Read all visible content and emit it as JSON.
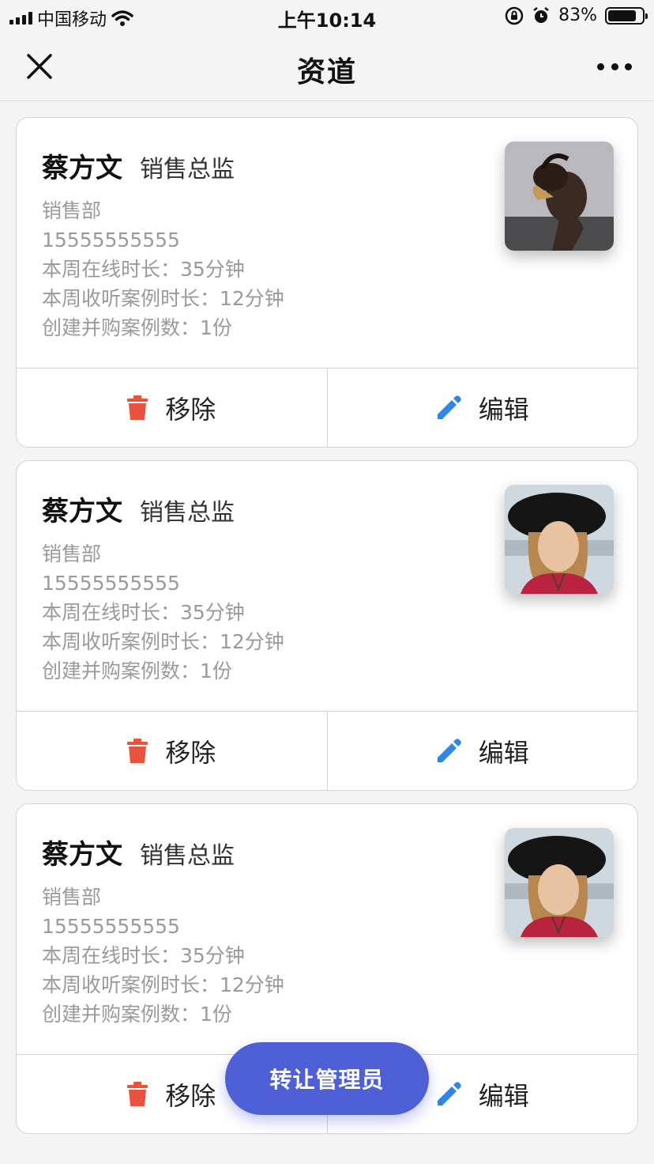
{
  "status_bar": {
    "carrier": "中国移动",
    "time": "上午10:14",
    "battery": "83%",
    "battery_level": 0.83
  },
  "nav": {
    "title": "资道"
  },
  "cards": [
    {
      "name": "蔡方文",
      "title": "销售总监",
      "department": "销售部",
      "phone": "15555555555",
      "online": "本周在线时长：35分钟",
      "listen": "本周收听案例时长：12分钟",
      "cases": "创建并购案例数：1份",
      "remove_label": "移除",
      "edit_label": "编辑"
    },
    {
      "name": "蔡方文",
      "title": "销售总监",
      "department": "销售部",
      "phone": "15555555555",
      "online": "本周在线时长：35分钟",
      "listen": "本周收听案例时长：12分钟",
      "cases": "创建并购案例数：1份",
      "remove_label": "移除",
      "edit_label": "编辑"
    },
    {
      "name": "蔡方文",
      "title": "销售总监",
      "department": "销售部",
      "phone": "15555555555",
      "online": "本周在线时长：35分钟",
      "listen": "本周收听案例时长：12分钟",
      "cases": "创建并购案例数：1份",
      "remove_label": "移除",
      "edit_label": "编辑"
    }
  ],
  "fab": {
    "label": "转让管理员"
  },
  "colors": {
    "remove_icon": "#e8533f",
    "edit_icon": "#2f86e6",
    "fab": "#4f5fd6"
  }
}
